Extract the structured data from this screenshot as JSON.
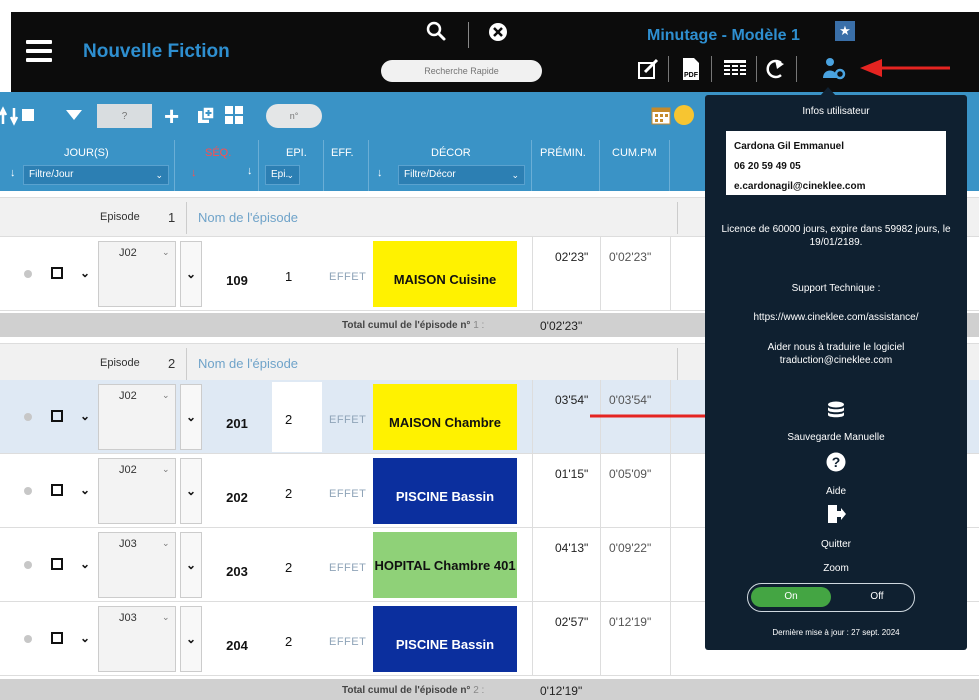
{
  "header": {
    "app_title": "Nouvelle Fiction",
    "quick_search_placeholder": "Recherche Rapide",
    "model_title": "Minutage - Modèle 1",
    "star": "★"
  },
  "toolbar": {
    "number_placeholder": "?",
    "n_placeholder": "n°"
  },
  "columns": {
    "days": "JOUR(S)",
    "days_filter": "Filtre/Jour",
    "seq": "SÉQ.",
    "epi": "EPI.",
    "epi_filter": "Epi.",
    "eff": "EFF.",
    "decor": "DÉCOR",
    "decor_filter": "Filtre/Décor",
    "premin": "PRÉMIN.",
    "cumpm": "CUM.PM"
  },
  "episodes": [
    {
      "label": "Episode",
      "number": "1",
      "name_placeholder": "Nom de l'épisode",
      "rows": [
        {
          "day": "J02",
          "seq": "109",
          "epi": "1",
          "effet": "EFFET",
          "decor": "MAISON Cuisine",
          "decor_bg": "#fff200",
          "decor_fg": "#111111",
          "premin": "02'23\"",
          "cumpm": "0'02'23\""
        }
      ],
      "total_label": "Total cumul de l'épisode n°",
      "total_num": "1 :",
      "total_value": "0'02'23\""
    },
    {
      "label": "Episode",
      "number": "2",
      "name_placeholder": "Nom de l'épisode",
      "rows": [
        {
          "day": "J02",
          "seq": "201",
          "epi": "2",
          "effet": "EFFET",
          "decor": "MAISON Chambre",
          "decor_bg": "#fff200",
          "decor_fg": "#111111",
          "premin": "03'54\"",
          "cumpm": "0'03'54\""
        },
        {
          "day": "J02",
          "seq": "202",
          "epi": "2",
          "effet": "EFFET",
          "decor": "PISCINE Bassin",
          "decor_bg": "#0b2f9e",
          "decor_fg": "#ffffff",
          "premin": "01'15\"",
          "cumpm": "0'05'09\""
        },
        {
          "day": "J03",
          "seq": "203",
          "epi": "2",
          "effet": "EFFET",
          "decor": "HOPITAL Chambre 401",
          "decor_bg": "#8fd178",
          "decor_fg": "#111111",
          "premin": "04'13\"",
          "cumpm": "0'09'22\""
        },
        {
          "day": "J03",
          "seq": "204",
          "epi": "2",
          "effet": "EFFET",
          "decor": "PISCINE Bassin",
          "decor_bg": "#0b2f9e",
          "decor_fg": "#ffffff",
          "premin": "02'57\"",
          "cumpm": "0'12'19\""
        }
      ],
      "total_label": "Total cumul de l'épisode n°",
      "total_num": "2 :",
      "total_value": "0'12'19\""
    }
  ],
  "popover": {
    "title": "Infos utilisateur",
    "user_name": "Cardona Gil Emmanuel",
    "user_phone": "06 20 59 49 05",
    "user_email": "e.cardonagil@cineklee.com",
    "licence": "Licence de 60000 jours, expire dans 59982 jours, le 19/01/2189.",
    "support_label": "Support Technique :",
    "support_url": "https://www.cineklee.com/assistance/",
    "translate_line1": "Aider nous à traduire le logiciel",
    "translate_line2": "traduction@cineklee.com",
    "save_label": "Sauvegarde Manuelle",
    "help_label": "Aide",
    "quit_label": "Quitter",
    "zoom_label": "Zoom",
    "zoom_on": "On",
    "zoom_off": "Off",
    "last_update": "Dernière mise à jour : 27 sept. 2024"
  },
  "colors": {
    "accent_blue": "#3a93c6",
    "title_blue": "#2e8fd0",
    "popover_bg": "#0f2030",
    "arrow_red": "#e52421",
    "zoom_on_green": "#44a543"
  }
}
